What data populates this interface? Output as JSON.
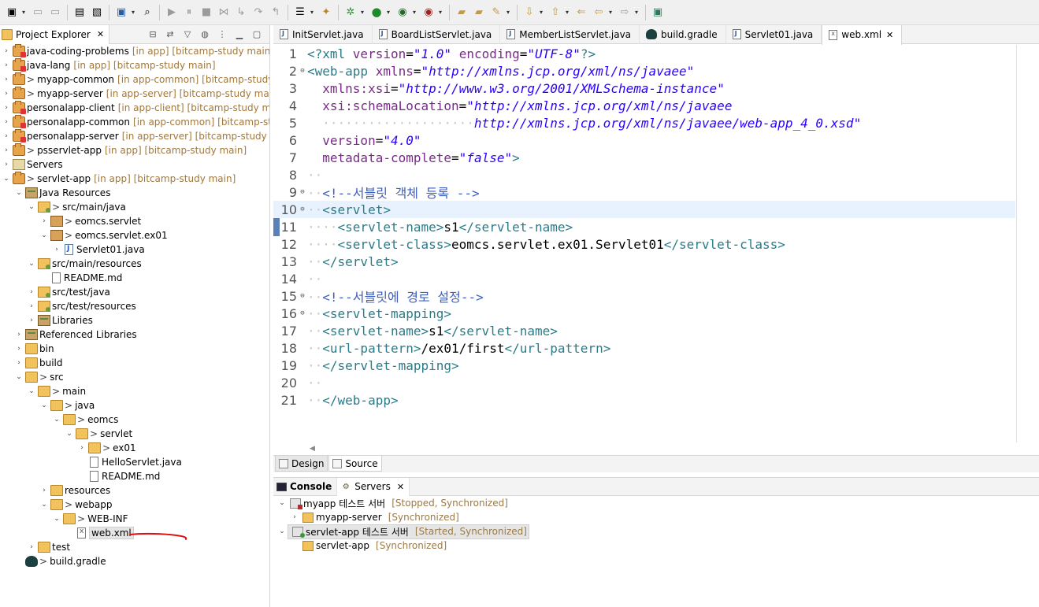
{
  "toolbar": {
    "icons": [
      "new-icon",
      "save-icon",
      "save-all-icon",
      "print-icon",
      "properties-icon",
      "console-icon",
      "search-icon",
      "resume-icon",
      "suspend-icon",
      "terminate-icon",
      "disconnect-icon",
      "step-into-icon",
      "step-over-icon",
      "step-return-icon",
      "task-icon",
      "open-type-icon",
      "debug-icon",
      "run-icon",
      "coverage-icon",
      "external-tools-icon",
      "open-folder-icon",
      "open-project-icon",
      "tools-icon",
      "next-annotation-icon",
      "prev-annotation-icon",
      "last-edit-icon",
      "back-icon",
      "forward-icon",
      "perspective-icon"
    ]
  },
  "project_explorer": {
    "title": "Project Explorer",
    "rows": [
      {
        "indent": 0,
        "twisty": "›",
        "icon": "proj err",
        "deco": "",
        "label": "java-coding-problems",
        "extra": "[in app] [bitcamp-study main]"
      },
      {
        "indent": 0,
        "twisty": "›",
        "icon": "proj err",
        "deco": "",
        "label": "java-lang",
        "extra": "[in app] [bitcamp-study main]"
      },
      {
        "indent": 0,
        "twisty": "›",
        "icon": "proj",
        "deco": ">",
        "label": "myapp-common",
        "extra": "[in app-common] [bitcamp-study ma"
      },
      {
        "indent": 0,
        "twisty": "›",
        "icon": "proj",
        "deco": ">",
        "label": "myapp-server",
        "extra": "[in app-server] [bitcamp-study main]"
      },
      {
        "indent": 0,
        "twisty": "›",
        "icon": "proj err",
        "deco": "",
        "label": "personalapp-client",
        "extra": "[in app-client] [bitcamp-study main]"
      },
      {
        "indent": 0,
        "twisty": "›",
        "icon": "proj err",
        "deco": "",
        "label": "personalapp-common",
        "extra": "[in app-common] [bitcamp-study"
      },
      {
        "indent": 0,
        "twisty": "›",
        "icon": "proj err",
        "deco": "",
        "label": "personalapp-server",
        "extra": "[in app-server] [bitcamp-study main]"
      },
      {
        "indent": 0,
        "twisty": "›",
        "icon": "proj",
        "deco": ">",
        "label": "psservlet-app",
        "extra": "[in app] [bitcamp-study main]"
      },
      {
        "indent": 0,
        "twisty": "›",
        "icon": "servers",
        "deco": "",
        "label": "Servers",
        "extra": ""
      },
      {
        "indent": 0,
        "twisty": "⌄",
        "icon": "proj",
        "deco": ">",
        "label": "servlet-app",
        "extra": "[in app] [bitcamp-study main]"
      },
      {
        "indent": 1,
        "twisty": "⌄",
        "icon": "lib",
        "deco": "",
        "label": "Java Resources",
        "extra": ""
      },
      {
        "indent": 2,
        "twisty": "⌄",
        "icon": "srcfolder",
        "deco": ">",
        "label": "src/main/java",
        "extra": ""
      },
      {
        "indent": 3,
        "twisty": "›",
        "icon": "pkg",
        "deco": ">",
        "label": "eomcs.servlet",
        "extra": ""
      },
      {
        "indent": 3,
        "twisty": "⌄",
        "icon": "pkg",
        "deco": ">",
        "label": "eomcs.servlet.ex01",
        "extra": ""
      },
      {
        "indent": 4,
        "twisty": "›",
        "icon": "java",
        "deco": "",
        "label": "Servlet01.java",
        "extra": ""
      },
      {
        "indent": 2,
        "twisty": "⌄",
        "icon": "srcfolder",
        "deco": "",
        "label": "src/main/resources",
        "extra": ""
      },
      {
        "indent": 3,
        "twisty": "",
        "icon": "file",
        "deco": "",
        "label": "README.md",
        "extra": ""
      },
      {
        "indent": 2,
        "twisty": "›",
        "icon": "srcfolder",
        "deco": "",
        "label": "src/test/java",
        "extra": ""
      },
      {
        "indent": 2,
        "twisty": "›",
        "icon": "srcfolder",
        "deco": "",
        "label": "src/test/resources",
        "extra": ""
      },
      {
        "indent": 2,
        "twisty": "›",
        "icon": "lib",
        "deco": "",
        "label": "Libraries",
        "extra": ""
      },
      {
        "indent": 1,
        "twisty": "›",
        "icon": "lib",
        "deco": "",
        "label": "Referenced Libraries",
        "extra": ""
      },
      {
        "indent": 1,
        "twisty": "›",
        "icon": "folder",
        "deco": "",
        "label": "bin",
        "extra": ""
      },
      {
        "indent": 1,
        "twisty": "›",
        "icon": "folder",
        "deco": "",
        "label": "build",
        "extra": ""
      },
      {
        "indent": 1,
        "twisty": "⌄",
        "icon": "folder",
        "deco": ">",
        "label": "src",
        "extra": ""
      },
      {
        "indent": 2,
        "twisty": "⌄",
        "icon": "folder",
        "deco": ">",
        "label": "main",
        "extra": ""
      },
      {
        "indent": 3,
        "twisty": "⌄",
        "icon": "folder",
        "deco": ">",
        "label": "java",
        "extra": ""
      },
      {
        "indent": 4,
        "twisty": "⌄",
        "icon": "folder",
        "deco": ">",
        "label": "eomcs",
        "extra": ""
      },
      {
        "indent": 5,
        "twisty": "⌄",
        "icon": "folder",
        "deco": ">",
        "label": "servlet",
        "extra": ""
      },
      {
        "indent": 6,
        "twisty": "›",
        "icon": "folder",
        "deco": ">",
        "label": "ex01",
        "extra": ""
      },
      {
        "indent": 6,
        "twisty": "",
        "icon": "file",
        "deco": "",
        "label": "HelloServlet.java",
        "extra": ""
      },
      {
        "indent": 6,
        "twisty": "",
        "icon": "file",
        "deco": "",
        "label": "README.md",
        "extra": ""
      },
      {
        "indent": 3,
        "twisty": "›",
        "icon": "folder",
        "deco": "",
        "label": "resources",
        "extra": ""
      },
      {
        "indent": 3,
        "twisty": "⌄",
        "icon": "folder",
        "deco": ">",
        "label": "webapp",
        "extra": ""
      },
      {
        "indent": 4,
        "twisty": "⌄",
        "icon": "folder",
        "deco": ">",
        "label": "WEB-INF",
        "extra": ""
      },
      {
        "indent": 5,
        "twisty": "",
        "icon": "xml",
        "deco": "",
        "label": "web.xml",
        "extra": "",
        "selected": true
      },
      {
        "indent": 2,
        "twisty": "›",
        "icon": "folder",
        "deco": "",
        "label": "test",
        "extra": ""
      },
      {
        "indent": 1,
        "twisty": "",
        "icon": "gradle",
        "deco": ">",
        "label": "build.gradle",
        "extra": ""
      }
    ]
  },
  "editor_tabs": [
    {
      "label": "InitServlet.java",
      "icon": "j",
      "active": false
    },
    {
      "label": "BoardListServlet.java",
      "icon": "j",
      "active": false
    },
    {
      "label": "MemberListServlet.java",
      "icon": "j",
      "active": false
    },
    {
      "label": "build.gradle",
      "icon": "g",
      "active": false
    },
    {
      "label": "Servlet01.java",
      "icon": "j",
      "active": false
    },
    {
      "label": "web.xml",
      "icon": "x",
      "active": true
    }
  ],
  "code_lines": [
    {
      "n": "1",
      "fold": "",
      "parts": [
        [
          "t-tag",
          "<?xml "
        ],
        [
          "t-attr",
          "version"
        ],
        [
          "t-txt",
          "="
        ],
        [
          "t-val",
          "\"1.0\""
        ],
        [
          "t-txt",
          " "
        ],
        [
          "t-attr",
          "encoding"
        ],
        [
          "t-txt",
          "="
        ],
        [
          "t-val",
          "\"UTF-8\""
        ],
        [
          "t-tag",
          "?>"
        ]
      ]
    },
    {
      "n": "2",
      "fold": "⊖",
      "parts": [
        [
          "t-tag",
          "<web-app "
        ],
        [
          "t-attr",
          "xmlns"
        ],
        [
          "t-txt",
          "="
        ],
        [
          "t-val",
          "\"http://xmlns.jcp.org/xml/ns/javaee\""
        ]
      ]
    },
    {
      "n": "3",
      "fold": "",
      "parts": [
        [
          "t-txt",
          "  "
        ],
        [
          "t-attr",
          "xmlns:xsi"
        ],
        [
          "t-txt",
          "="
        ],
        [
          "t-val",
          "\"http://www.w3.org/2001/XMLSchema-instance\""
        ]
      ]
    },
    {
      "n": "4",
      "fold": "",
      "parts": [
        [
          "t-txt",
          "  "
        ],
        [
          "t-attr",
          "xsi:schemaLocation"
        ],
        [
          "t-txt",
          "="
        ],
        [
          "t-val",
          "\"http://xmlns.jcp.org/xml/ns/javaee"
        ]
      ]
    },
    {
      "n": "5",
      "fold": "",
      "parts": [
        [
          "t-dot",
          "  ····················"
        ],
        [
          "t-val",
          "http://xmlns.jcp.org/xml/ns/javaee/web-app_4_0.xsd\""
        ]
      ]
    },
    {
      "n": "6",
      "fold": "",
      "parts": [
        [
          "t-txt",
          "  "
        ],
        [
          "t-attr",
          "version"
        ],
        [
          "t-txt",
          "="
        ],
        [
          "t-val",
          "\"4.0\""
        ]
      ]
    },
    {
      "n": "7",
      "fold": "",
      "parts": [
        [
          "t-txt",
          "  "
        ],
        [
          "t-attr",
          "metadata-complete"
        ],
        [
          "t-txt",
          "="
        ],
        [
          "t-val",
          "\"false\""
        ],
        [
          "t-tag",
          ">"
        ]
      ]
    },
    {
      "n": "8",
      "fold": "",
      "parts": [
        [
          "t-dot",
          "··"
        ]
      ]
    },
    {
      "n": "9",
      "fold": "⊖",
      "parts": [
        [
          "t-dot",
          "··"
        ],
        [
          "t-cmt",
          "<!--서블릿 객체 등록 -->"
        ]
      ]
    },
    {
      "n": "10",
      "fold": "⊖",
      "parts": [
        [
          "t-dot",
          "··"
        ],
        [
          "t-tag",
          "<servlet>"
        ]
      ],
      "current": true
    },
    {
      "n": "11",
      "fold": "",
      "parts": [
        [
          "t-dot",
          "····"
        ],
        [
          "t-tag",
          "<servlet-name>"
        ],
        [
          "t-txt",
          "s1"
        ],
        [
          "t-tag",
          "</servlet-name>"
        ]
      ]
    },
    {
      "n": "12",
      "fold": "",
      "parts": [
        [
          "t-dot",
          "····"
        ],
        [
          "t-tag",
          "<servlet-class>"
        ],
        [
          "t-txt",
          "eomcs.servlet.ex01.Servlet01"
        ],
        [
          "t-tag",
          "</servlet-class>"
        ]
      ]
    },
    {
      "n": "13",
      "fold": "",
      "parts": [
        [
          "t-dot",
          "··"
        ],
        [
          "t-tag",
          "</servlet>"
        ]
      ]
    },
    {
      "n": "14",
      "fold": "",
      "parts": [
        [
          "t-dot",
          "··"
        ]
      ]
    },
    {
      "n": "15",
      "fold": "⊖",
      "parts": [
        [
          "t-dot",
          "··"
        ],
        [
          "t-cmt",
          "<!--서블릿에 경로 설정-->"
        ]
      ]
    },
    {
      "n": "16",
      "fold": "⊖",
      "parts": [
        [
          "t-dot",
          "··"
        ],
        [
          "t-tag",
          "<servlet-mapping>"
        ]
      ]
    },
    {
      "n": "17",
      "fold": "",
      "parts": [
        [
          "t-dot",
          "··"
        ],
        [
          "t-tag",
          "<servlet-name>"
        ],
        [
          "t-txt",
          "s1"
        ],
        [
          "t-tag",
          "</servlet-name>"
        ]
      ]
    },
    {
      "n": "18",
      "fold": "",
      "parts": [
        [
          "t-dot",
          "··"
        ],
        [
          "t-tag",
          "<url-pattern>"
        ],
        [
          "t-txt",
          "/ex01/first"
        ],
        [
          "t-tag",
          "</url-pattern>"
        ]
      ]
    },
    {
      "n": "19",
      "fold": "",
      "parts": [
        [
          "t-dot",
          "··"
        ],
        [
          "t-tag",
          "</servlet-mapping>"
        ]
      ]
    },
    {
      "n": "20",
      "fold": "",
      "parts": [
        [
          "t-dot",
          "··"
        ]
      ]
    },
    {
      "n": "21",
      "fold": "",
      "parts": [
        [
          "t-dot",
          "··"
        ],
        [
          "t-tag",
          "</web-app>"
        ]
      ]
    }
  ],
  "design_tabs": {
    "design": "Design",
    "source": "Source"
  },
  "bottom_tabs": {
    "console": "Console",
    "servers": "Servers"
  },
  "servers": [
    {
      "indent": 0,
      "twisty": "⌄",
      "icon": "stopped",
      "label": "myapp 테스트 서버",
      "status": "[Stopped, Synchronized]",
      "selected": false
    },
    {
      "indent": 1,
      "twisty": "›",
      "icon": "mod",
      "label": "myapp-server",
      "status": "[Synchronized]",
      "selected": false
    },
    {
      "indent": 0,
      "twisty": "⌄",
      "icon": "started",
      "label": "servlet-app 테스트 서버",
      "status": "[Started, Synchronized]",
      "selected": true
    },
    {
      "indent": 1,
      "twisty": "",
      "icon": "mod",
      "label": "servlet-app",
      "status": "[Synchronized]",
      "selected": false
    }
  ]
}
